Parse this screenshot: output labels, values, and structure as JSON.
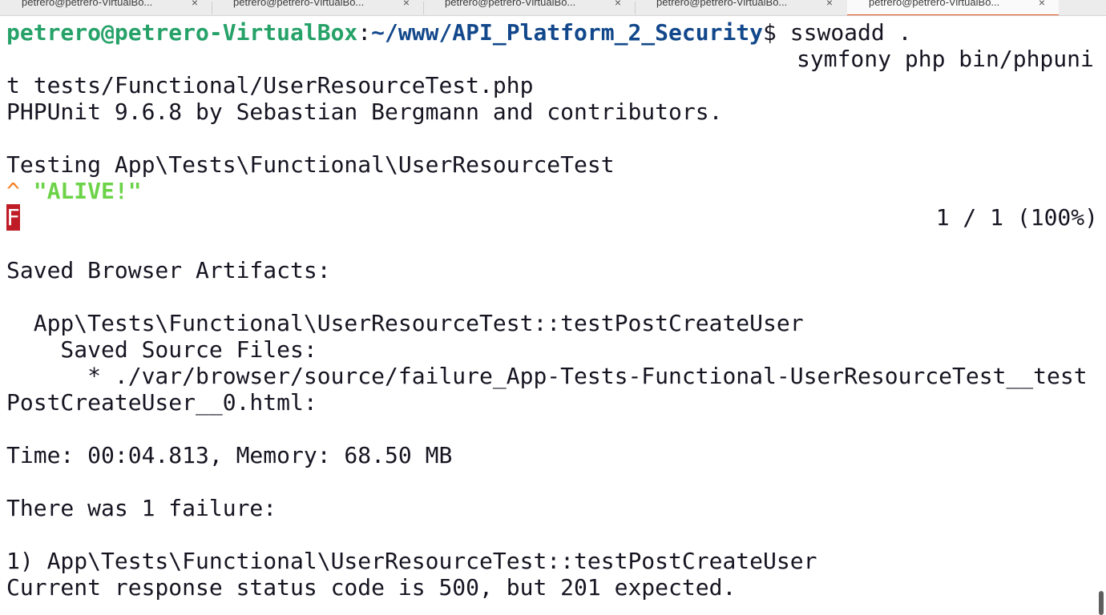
{
  "tabs": [
    {
      "title": "petrero@petrero-VirtualBo...",
      "close": "×",
      "active": false
    },
    {
      "title": "petrero@petrero-VirtualBo...",
      "close": "×",
      "active": false
    },
    {
      "title": "petrero@petrero-VirtualBo...",
      "close": "×",
      "active": false
    },
    {
      "title": "petrero@petrero-VirtualBo...",
      "close": "×",
      "active": false
    },
    {
      "title": "petrero@petrero-VirtualBo...",
      "close": "×",
      "active": true
    }
  ],
  "prompt": {
    "user_host": "petrero@petrero-VirtualBox",
    "colon": ":",
    "path": "~/www/API_Platform_2_Security",
    "dollar": "$ ",
    "command": "sswoadd .",
    "command_wrap_1": "symfony php bin/phpuni",
    "command_wrap_2": "t tests/Functional/UserResourceTest.php"
  },
  "output": {
    "phpunit_header": "PHPUnit 9.6.8 by Sebastian Bergmann and contributors.",
    "testing": "Testing App\\Tests\\Functional\\UserResourceTest",
    "caret": "^ ",
    "alive": "\"ALIVE!\"",
    "fail_marker": "F",
    "progress": "1 / 1 (100%)",
    "saved_artifacts": "Saved Browser Artifacts:",
    "artifact_test": "  App\\Tests\\Functional\\UserResourceTest::testPostCreateUser",
    "saved_sources": "    Saved Source Files:",
    "source_file_1": "      * ./var/browser/source/failure_App-Tests-Functional-UserResourceTest__test",
    "source_file_2": "PostCreateUser__0.html:",
    "time_memory": "Time: 00:04.813, Memory: 68.50 MB",
    "failure_count": "There was 1 failure:",
    "failure_item": "1) App\\Tests\\Functional\\UserResourceTest::testPostCreateUser",
    "failure_message": "Current response status code is 500, but 201 expected."
  },
  "colors": {
    "prompt_user": "#26a269",
    "prompt_path": "#12488b",
    "caret": "#f37b1d",
    "alive": "#6cd349",
    "fail_badge": "#c01c28",
    "tab_accent": "#e95420"
  }
}
